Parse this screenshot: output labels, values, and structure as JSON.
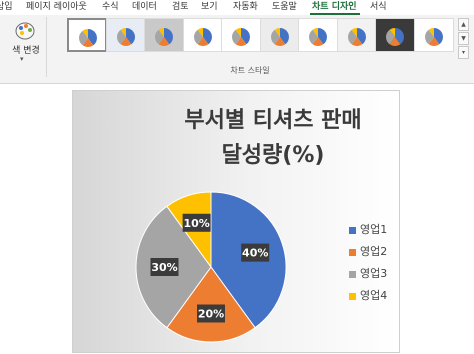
{
  "ribbon": {
    "tabs": [
      {
        "label": "삽입"
      },
      {
        "label": "페이지 레이아웃"
      },
      {
        "label": "수식"
      },
      {
        "label": "데이터"
      },
      {
        "label": "검토"
      },
      {
        "label": "보기"
      },
      {
        "label": "자동화"
      },
      {
        "label": "도움말"
      },
      {
        "label": "차트 디자인"
      },
      {
        "label": "서식"
      }
    ],
    "active_tab": "차트 디자인",
    "change_colors_label": "색 변경",
    "group_label": "차트 스타일",
    "styles_count_visible": 10,
    "accent_color": "#1e6f3c"
  },
  "chart_data": {
    "type": "pie",
    "title": "부서별 티셔츠 판매 달성량(%)",
    "categories": [
      "영업1",
      "영업2",
      "영업3",
      "영업4"
    ],
    "values": [
      40,
      20,
      30,
      10
    ],
    "data_labels": [
      "40%",
      "20%",
      "30%",
      "10%"
    ],
    "colors": [
      "#4472c4",
      "#ed7d31",
      "#a5a5a5",
      "#ffc000"
    ],
    "legend_position": "right",
    "legend": [
      "영업1",
      "영업2",
      "영업3",
      "영업4"
    ]
  }
}
